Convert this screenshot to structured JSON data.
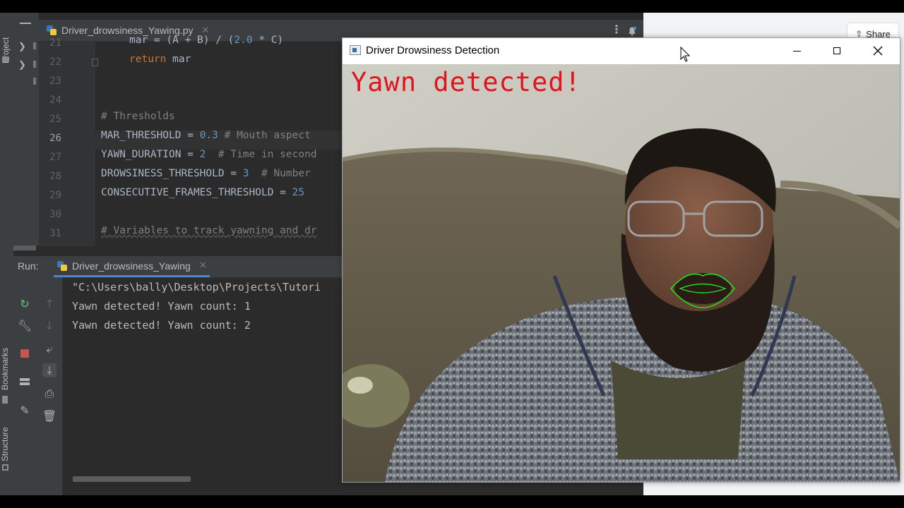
{
  "ide": {
    "left_strip": {
      "project_label": "Project",
      "bookmarks_label": "Bookmarks",
      "structure_label": "Structure"
    },
    "editor_tab": {
      "filename": "Driver_drowsiness_Yawing.py"
    },
    "lines": [
      {
        "num": "21",
        "text": "    mar = (A + B) / (2.0 * C)"
      },
      {
        "num": "22",
        "text": "    return mar"
      },
      {
        "num": "23",
        "text": ""
      },
      {
        "num": "24",
        "text": ""
      },
      {
        "num": "25",
        "text": "# Thresholds"
      },
      {
        "num": "26",
        "text": "MAR_THRESHOLD = 0.3 # Mouth aspect"
      },
      {
        "num": "27",
        "text": "YAWN_DURATION = 2  # Time in second"
      },
      {
        "num": "28",
        "text": "DROWSINESS_THRESHOLD = 3  # Number"
      },
      {
        "num": "29",
        "text": "CONSECUTIVE_FRAMES_THRESHOLD = 25"
      },
      {
        "num": "30",
        "text": ""
      },
      {
        "num": "31",
        "text": "# Variables to track yawning and dr"
      }
    ],
    "code": {
      "l21_a": "mar = (A + B) / (",
      "l21_num": "2.0",
      "l21_b": " * C)",
      "l22_kw": "return",
      "l22_rest": " mar",
      "l25_comment": "# Thresholds",
      "l26_name": "MAR_THRESHOLD = ",
      "l26_num": "0.3",
      "l26_comment": " # Mouth aspect",
      "l27_name": "YAWN_DURATION = ",
      "l27_num": "2",
      "l27_comment": "  # Time in second",
      "l28_name": "DROWSINESS_THRESHOLD = ",
      "l28_num": "3",
      "l28_comment": "  # Number",
      "l29_name": "CONSECUTIVE_FRAMES_THRESHOLD = ",
      "l29_num": "25",
      "l31_comment": "# Variables to track yawning and dr"
    },
    "run": {
      "label": "Run:",
      "tab_name": "Driver_drowsiness_Yawing",
      "output": [
        "\"C:\\Users\\bally\\Desktop\\Projects\\Tutori",
        "Yawn detected! Yawn count: 1",
        "Yawn detected! Yawn count: 2"
      ]
    },
    "colors": {
      "keyword": "#cc7832",
      "number": "#6897bb",
      "comment": "#808080",
      "text": "#a9b7c6"
    }
  },
  "browser": {
    "share_label": "Share"
  },
  "cv_window": {
    "title": "Driver Drowsiness Detection",
    "overlay_text": "Yawn detected!",
    "overlay_color": "#e0141e",
    "lip_contour_color": "#22dd22"
  }
}
